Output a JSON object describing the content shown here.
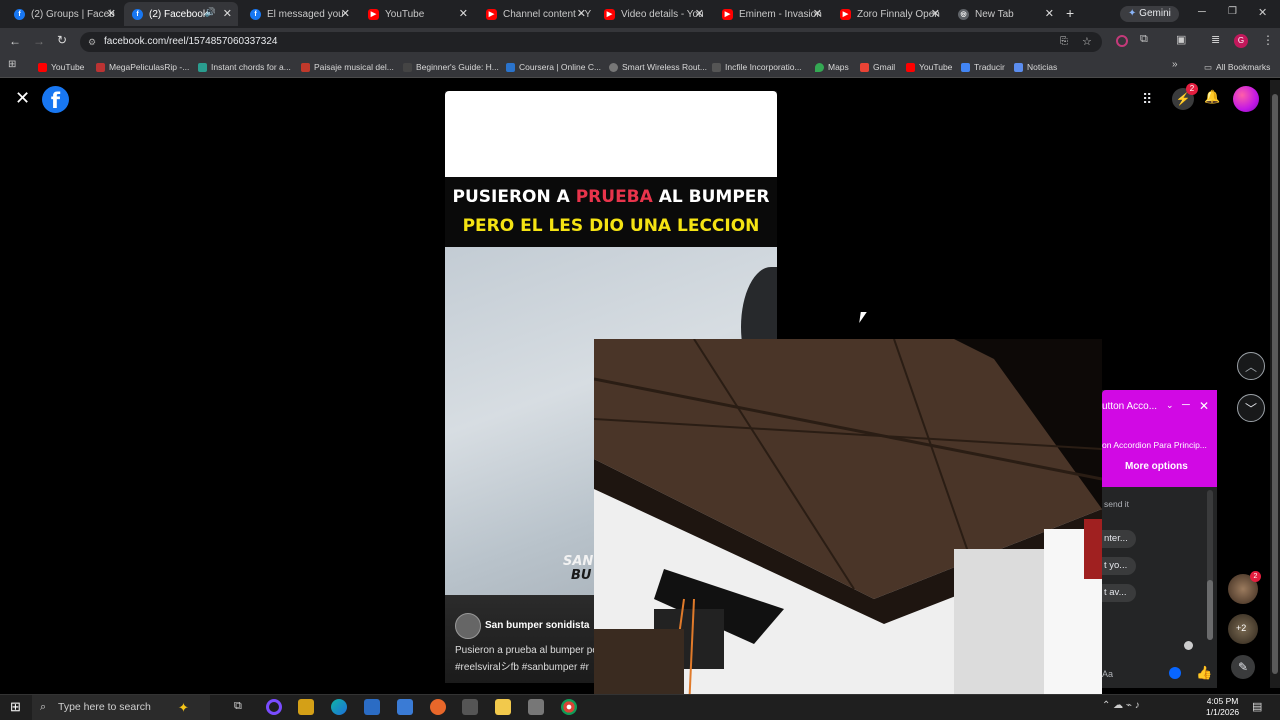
{
  "browser": {
    "tabs": [
      {
        "title": "(2) Groups | Faceb",
        "icon": "facebook-icon"
      },
      {
        "title": "(2) Facebook",
        "icon": "facebook-icon",
        "active": true
      },
      {
        "title": "El messaged you",
        "icon": "facebook-icon"
      },
      {
        "title": "YouTube",
        "icon": "youtube-icon"
      },
      {
        "title": "Channel content - Y",
        "icon": "youtube-icon"
      },
      {
        "title": "Video details - You",
        "icon": "youtube-icon"
      },
      {
        "title": "Eminem - Invasion",
        "icon": "youtube-icon"
      },
      {
        "title": "Zoro Finnaly Open",
        "icon": "youtube-icon"
      },
      {
        "title": "New Tab",
        "icon": "chrome-icon"
      }
    ],
    "gemini_label": "Gemini",
    "url": "facebook.com/reel/1574857060337324",
    "bookmarks": [
      "YouTube",
      "MegaPeliculasRip -...",
      "Instant chords for a...",
      "Paisaje musical del...",
      "Beginner's Guide: H...",
      "Coursera | Online C...",
      "Smart Wireless Rout...",
      "Incfile Incorporatio...",
      "Maps",
      "Gmail",
      "YouTube",
      "Traducir",
      "Noticias"
    ],
    "all_bookmarks": "All Bookmarks",
    "profile_letter": "G"
  },
  "facebook": {
    "logo_letter": "f",
    "messenger_badge": "2",
    "reel": {
      "title_line1_a": "PUSIERON A",
      "title_line1_b": "PRUEBA",
      "title_line1_c": "AL BUMPER",
      "title_line2": "PERO EL LES DIO UNA LECCION",
      "overlay_text_1": "SAN",
      "overlay_text_2": "BU",
      "author": "San bumper sonidista",
      "caption": "Pusieron a prueba al bumper pe",
      "hashtags": "#reelsviralシfb #sanbumper #r"
    },
    "chat": {
      "title": "utton Acco...",
      "subtitle": "on Accordion Para Princip...",
      "more_options": "More options",
      "snippet": "send it",
      "replies": [
        "nter...",
        "t yo...",
        "t av..."
      ],
      "input_placeholder": "Aa",
      "badge_count": "2",
      "more_count": "+2"
    },
    "colors": {
      "accent": "#d109e4",
      "fb_blue": "#1877f2",
      "title_red": "#e8344b",
      "title_yellow": "#f5e313",
      "badge_red": "#e41e3f"
    }
  },
  "taskbar": {
    "search_placeholder": "Type here to search",
    "time": "4:05 PM",
    "date": "1/1/2026"
  }
}
